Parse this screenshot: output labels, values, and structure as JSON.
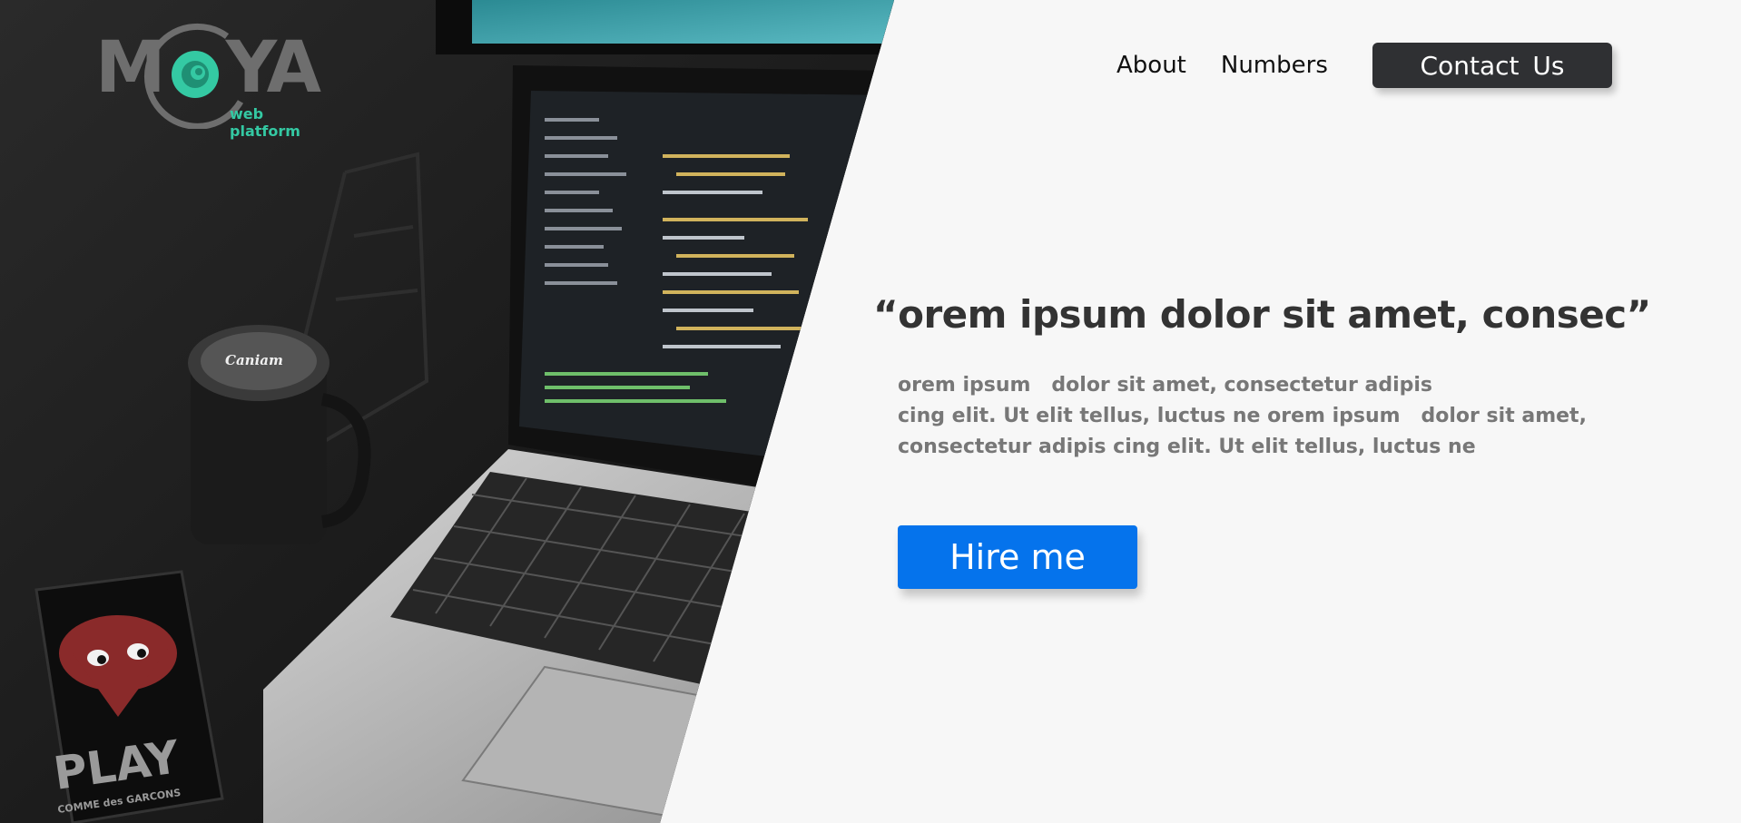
{
  "brand": {
    "logo_text_left": "M",
    "logo_text_right": "YA",
    "logo_subtitle": "web platform",
    "accent_color": "#34c9a3",
    "logo_gray": "#6e6e6e"
  },
  "nav": {
    "items": [
      {
        "label": "About"
      },
      {
        "label": "Numbers"
      }
    ],
    "contact_label": "Contact  Us"
  },
  "hero": {
    "title": "“orem ipsum   dolor sit amet, consec”",
    "body_lines": [
      "orem ipsum   dolor sit amet, consectetur adipis",
      "cing elit. Ut elit tellus, luctus ne orem ipsum   dolor sit amet,",
      "consectetur adipis cing elit. Ut elit tellus, luctus ne"
    ],
    "cta_label": "Hire me",
    "cta_color": "#0573ec"
  },
  "photo": {
    "lens_cap_text": "Caniam",
    "phone_text": "PLAY",
    "phone_subtext": "COMME des GARCONS"
  }
}
